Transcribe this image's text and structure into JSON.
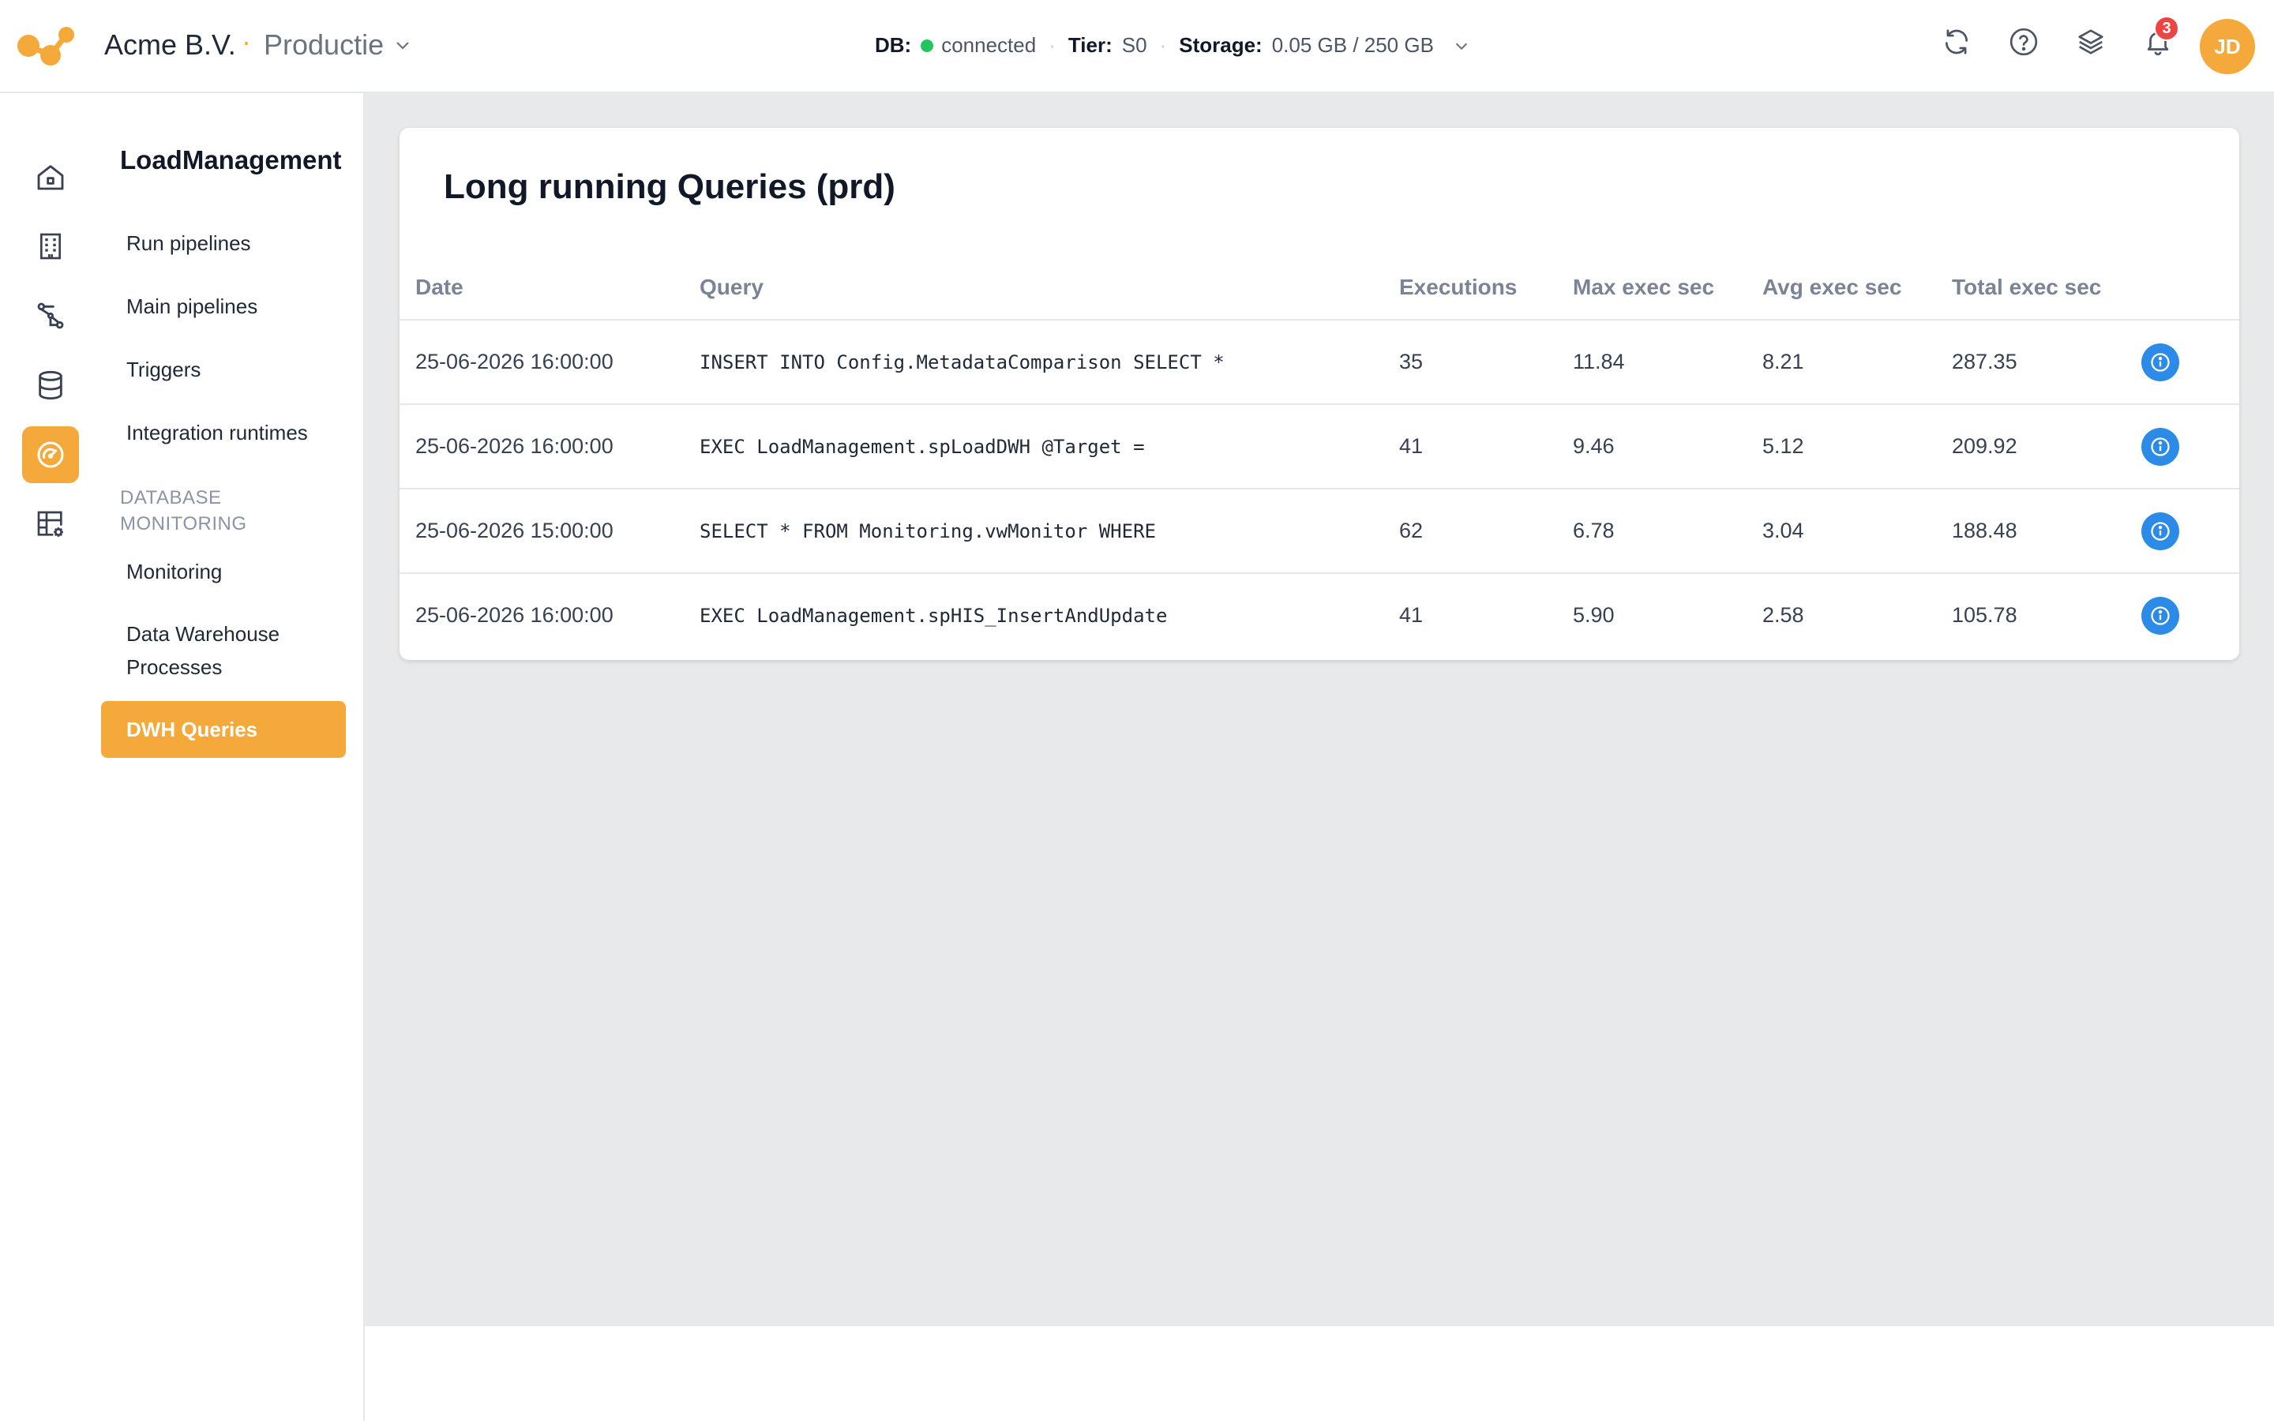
{
  "header": {
    "org_name": "Acme B.V.",
    "separator": "·",
    "environment": "Productie",
    "db_label": "DB:",
    "db_status": "connected",
    "tier_label": "Tier:",
    "tier_value": "S0",
    "storage_label": "Storage:",
    "storage_value": "0.05 GB / 250 GB",
    "notification_count": "3",
    "avatar_initials": "JD",
    "icons": [
      "refresh-icon",
      "help-icon",
      "layers-icon",
      "bell-icon"
    ]
  },
  "rail": {
    "items": [
      "home-icon",
      "building-icon",
      "pipeline-icon",
      "database-icon",
      "gauge-icon",
      "table-settings-icon"
    ],
    "active": "gauge-icon"
  },
  "subnav": {
    "title": "LoadManagement",
    "links": [
      "Run pipelines",
      "Main pipelines",
      "Triggers",
      "Integration runtimes"
    ],
    "section_label": "DATABASE MONITORING",
    "section_links": [
      "Monitoring",
      "Data Warehouse Processes"
    ],
    "active_link": "DWH Queries"
  },
  "main": {
    "card_title": "Long running Queries (prd)",
    "columns": [
      "Date",
      "Query",
      "Executions",
      "Max exec sec",
      "Avg exec sec",
      "Total exec sec"
    ],
    "rows": [
      {
        "date": "25-06-2026 16:00:00",
        "query": "INSERT INTO Config.MetadataComparison SELECT *",
        "executions": "35",
        "max": "11.84",
        "avg": "8.21",
        "total": "287.35"
      },
      {
        "date": "25-06-2026 16:00:00",
        "query": "EXEC LoadManagement.spLoadDWH @Target =",
        "executions": "41",
        "max": "9.46",
        "avg": "5.12",
        "total": "209.92"
      },
      {
        "date": "25-06-2026 15:00:00",
        "query": "SELECT * FROM Monitoring.vwMonitor WHERE",
        "executions": "62",
        "max": "6.78",
        "avg": "3.04",
        "total": "188.48"
      },
      {
        "date": "25-06-2026 16:00:00",
        "query": "EXEC LoadManagement.spHIS_InsertAndUpdate",
        "executions": "41",
        "max": "5.90",
        "avg": "2.58",
        "total": "105.78"
      }
    ]
  },
  "colors": {
    "accent": "#f6a93b",
    "info": "#2b8be6",
    "connected": "#22c55e",
    "badge": "#ef4444"
  }
}
